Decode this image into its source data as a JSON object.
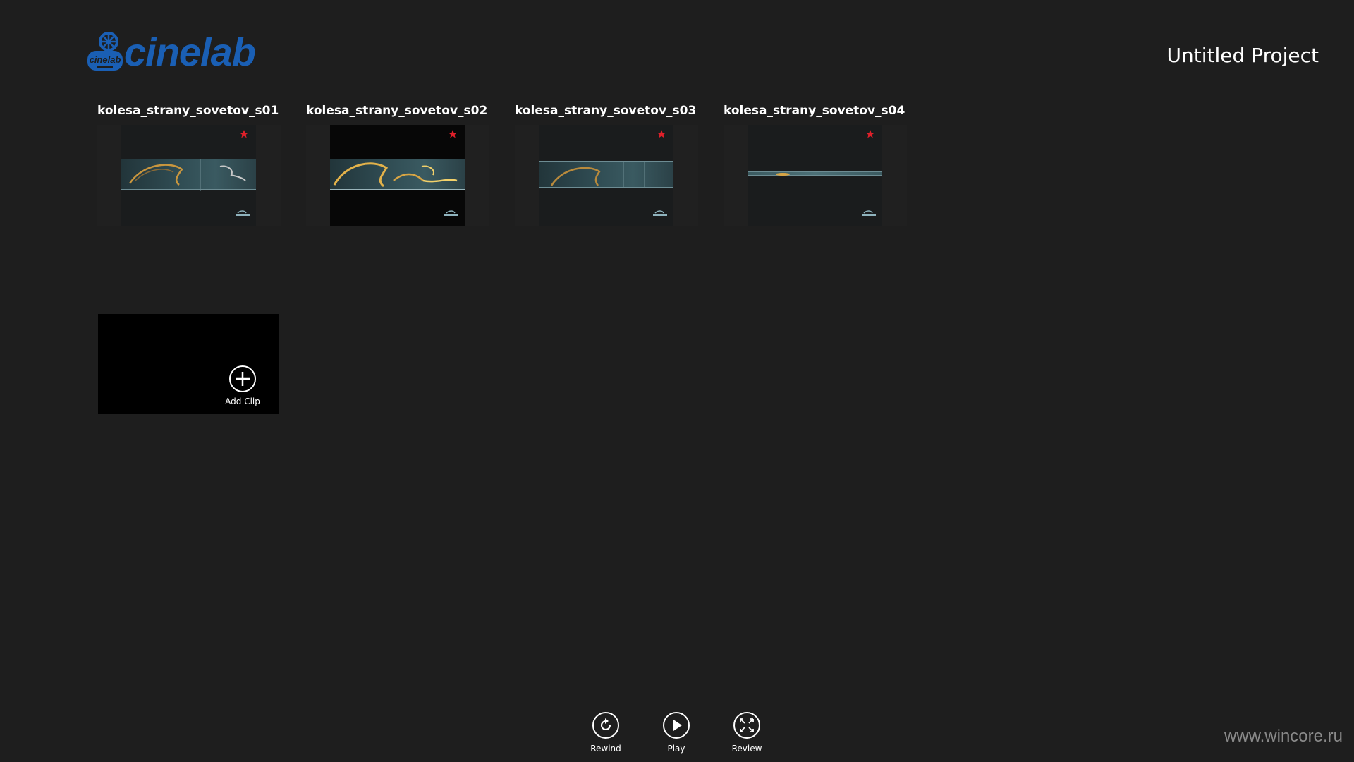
{
  "app": {
    "logo_text": "cinelab",
    "logo_badge_text": "cinelab",
    "project_title": "Untitled Project"
  },
  "clips": [
    {
      "title": "kolesa_strany_sovetov_s01",
      "style": "normal"
    },
    {
      "title": "kolesa_strany_sovetov_s02",
      "style": "dark"
    },
    {
      "title": "kolesa_strany_sovetov_s03",
      "style": "normal"
    },
    {
      "title": "kolesa_strany_sovetov_s04",
      "style": "thin"
    }
  ],
  "add_clip": {
    "label": "Add Clip",
    "icon": "plus-circle-icon"
  },
  "appbar": [
    {
      "label": "Rewind",
      "icon": "rewind-icon"
    },
    {
      "label": "Play",
      "icon": "play-icon"
    },
    {
      "label": "Review",
      "icon": "fullscreen-icon"
    }
  ],
  "watermark": "www.wincore.ru",
  "colors": {
    "background": "#1e1e1e",
    "brand_blue": "#1a5fb4",
    "star_red": "#e0202a"
  }
}
